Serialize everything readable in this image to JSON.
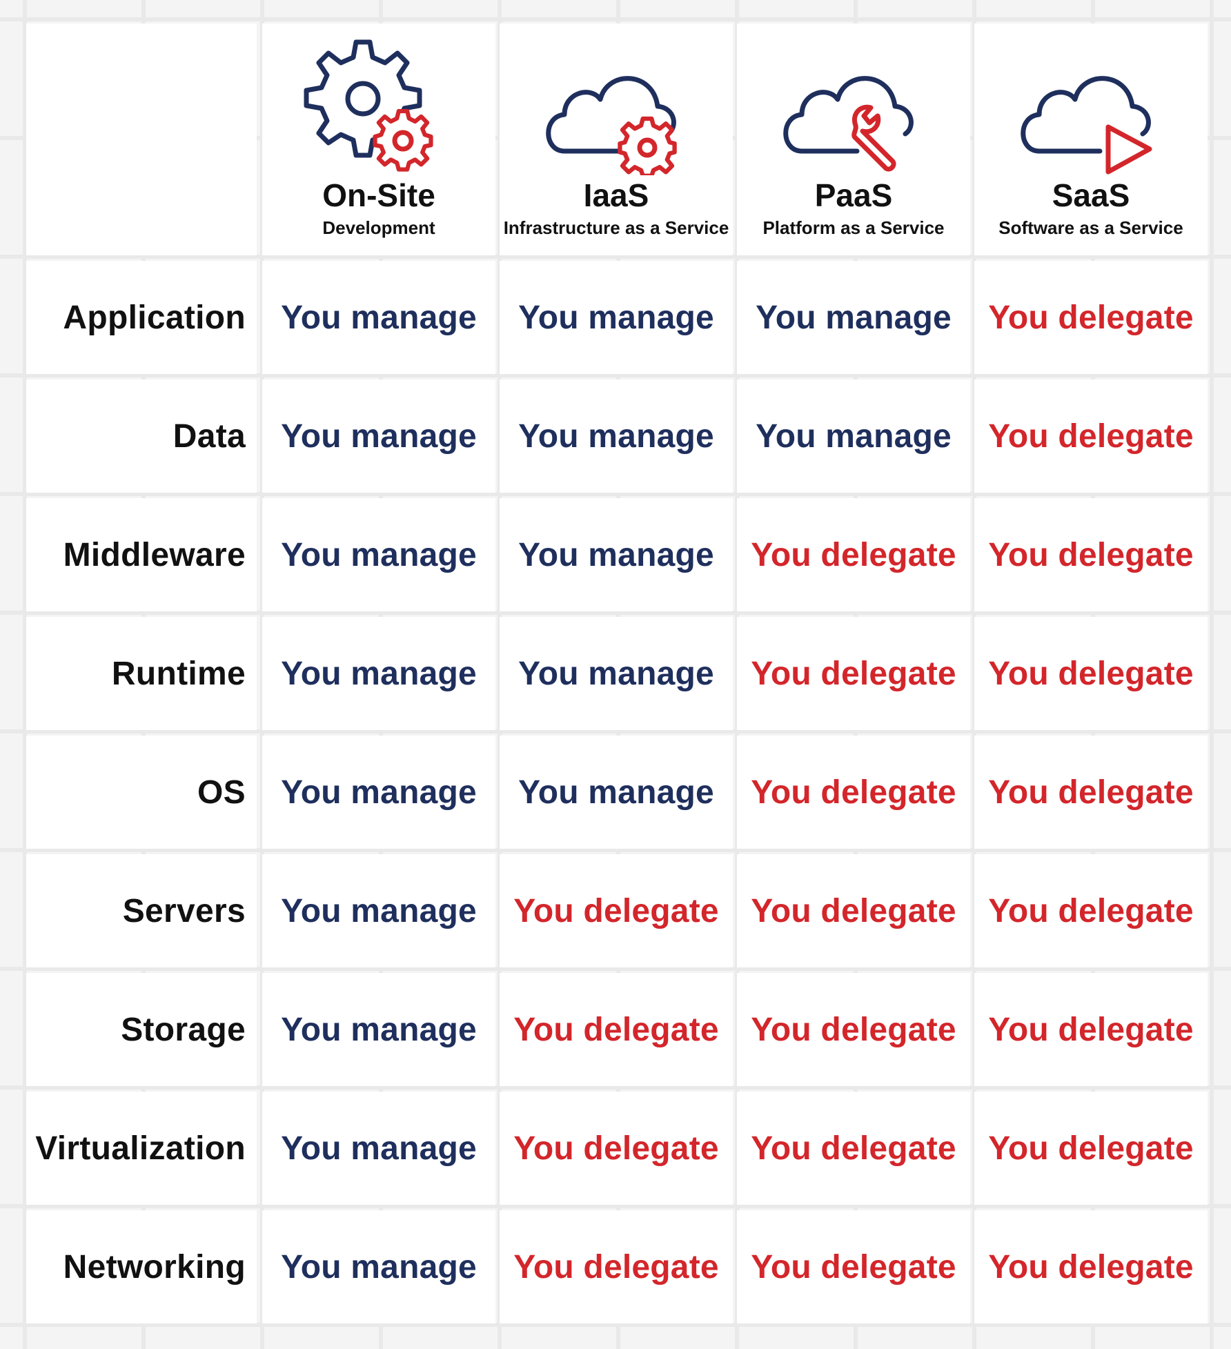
{
  "colors": {
    "manage": "#1f2f5d",
    "delegate": "#d3262b",
    "label": "#111111",
    "background": "#f4f4f4"
  },
  "columns": [
    {
      "title": "On-Site",
      "subtitle": "Development",
      "icon": "gear-icon"
    },
    {
      "title": "IaaS",
      "subtitle": "Infrastructure as a Service",
      "icon": "cloud-gear-icon"
    },
    {
      "title": "PaaS",
      "subtitle": "Platform as a Service",
      "icon": "cloud-wrench-icon"
    },
    {
      "title": "SaaS",
      "subtitle": "Software as a Service",
      "icon": "cloud-play-icon"
    }
  ],
  "rows": [
    {
      "label": "Application",
      "values": [
        "You manage",
        "You manage",
        "You manage",
        "You delegate"
      ]
    },
    {
      "label": "Data",
      "values": [
        "You manage",
        "You manage",
        "You manage",
        "You delegate"
      ]
    },
    {
      "label": "Middleware",
      "values": [
        "You manage",
        "You manage",
        "You delegate",
        "You delegate"
      ]
    },
    {
      "label": "Runtime",
      "values": [
        "You manage",
        "You manage",
        "You delegate",
        "You delegate"
      ]
    },
    {
      "label": "OS",
      "values": [
        "You manage",
        "You manage",
        "You delegate",
        "You delegate"
      ]
    },
    {
      "label": "Servers",
      "values": [
        "You manage",
        "You delegate",
        "You delegate",
        "You delegate"
      ]
    },
    {
      "label": "Storage",
      "values": [
        "You manage",
        "You delegate",
        "You delegate",
        "You delegate"
      ]
    },
    {
      "label": "Virtualization",
      "values": [
        "You manage",
        "You delegate",
        "You delegate",
        "You delegate"
      ]
    },
    {
      "label": "Networking",
      "values": [
        "You manage",
        "You delegate",
        "You delegate",
        "You delegate"
      ]
    }
  ]
}
